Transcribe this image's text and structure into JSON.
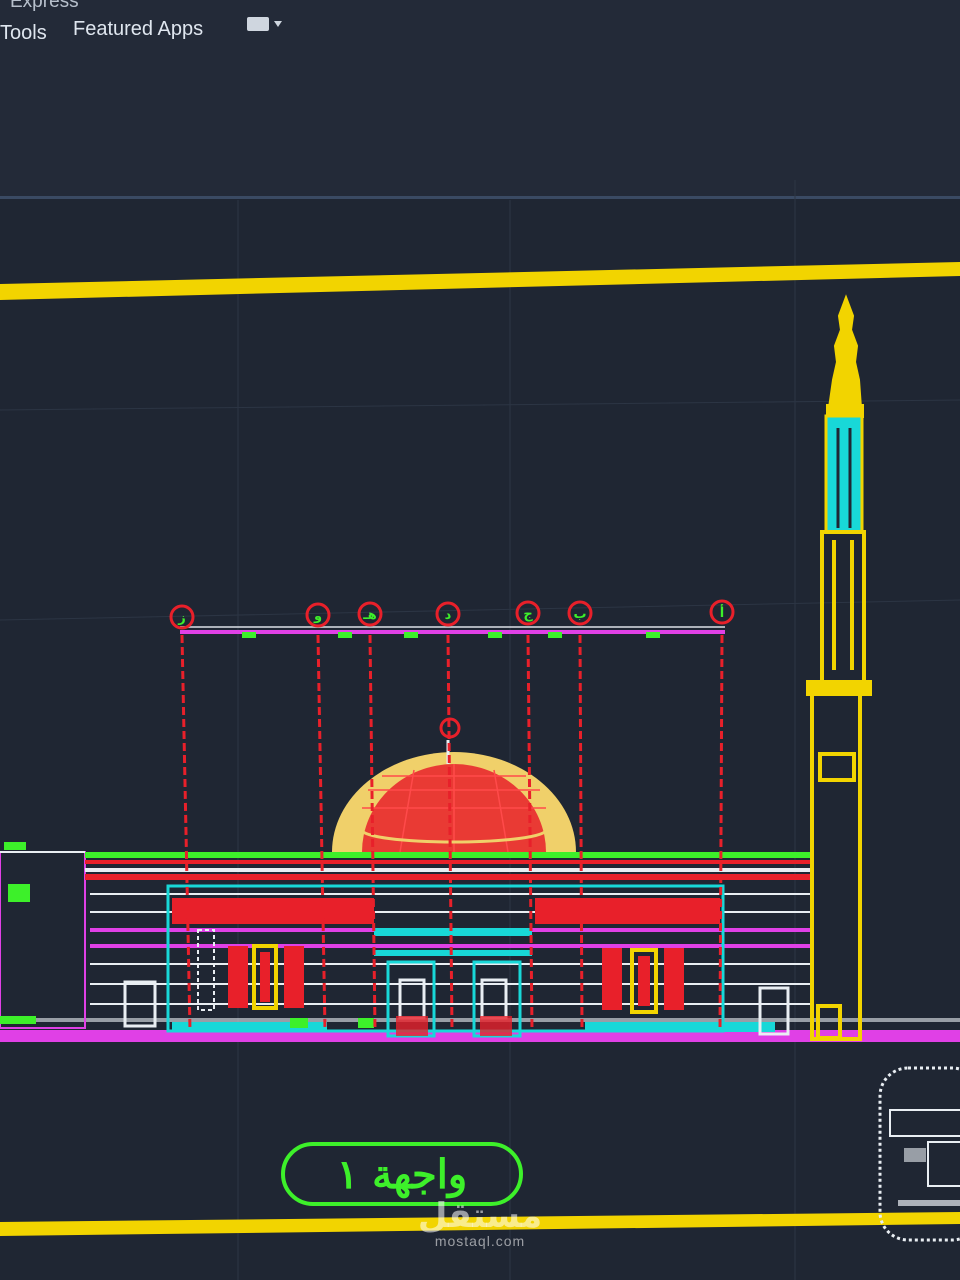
{
  "ribbon": {
    "tabs": [
      {
        "label": "Express"
      },
      {
        "label": "Tools"
      },
      {
        "label": "Featured Apps"
      }
    ],
    "dropdown_icon": "panel-dropdown-icon"
  },
  "drawing": {
    "elevation_label": "واجهة ١",
    "grid_markers": [
      "ز",
      "و",
      "هـ",
      "د",
      "ج",
      "ب",
      "أ"
    ],
    "colors": {
      "background": "#1f2633",
      "frame": "#f2d400",
      "magenta": "#e040e6",
      "red": "#e8202a",
      "green": "#3df02a",
      "cyan": "#18d8d8",
      "yellow": "#f2d400",
      "white": "#e9eef3"
    }
  },
  "watermark": {
    "main": "مستقل",
    "sub": "mostaql.com"
  }
}
